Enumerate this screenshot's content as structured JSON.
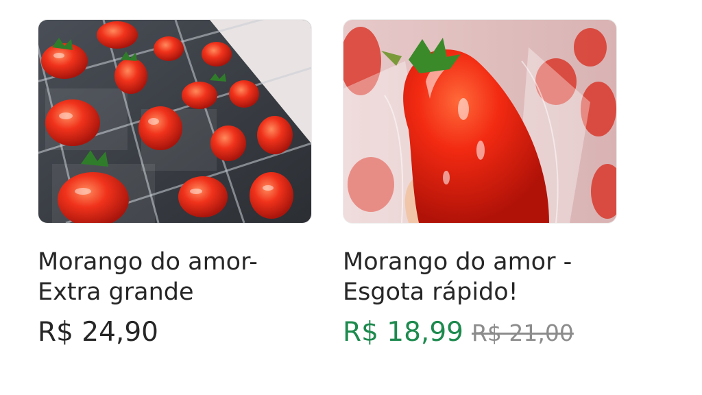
{
  "products": [
    {
      "title": "Morango do amor-\nExtra grande",
      "price": "R$ 24,90",
      "image_icon": "strawberry-trays-photo"
    },
    {
      "title": "Morango do amor -\nEsgota  rápido!",
      "price": "R$ 18,99",
      "old_price": "R$ 21,00",
      "price_color": "#1d8a4e",
      "image_icon": "candied-strawberry-photo"
    }
  ]
}
